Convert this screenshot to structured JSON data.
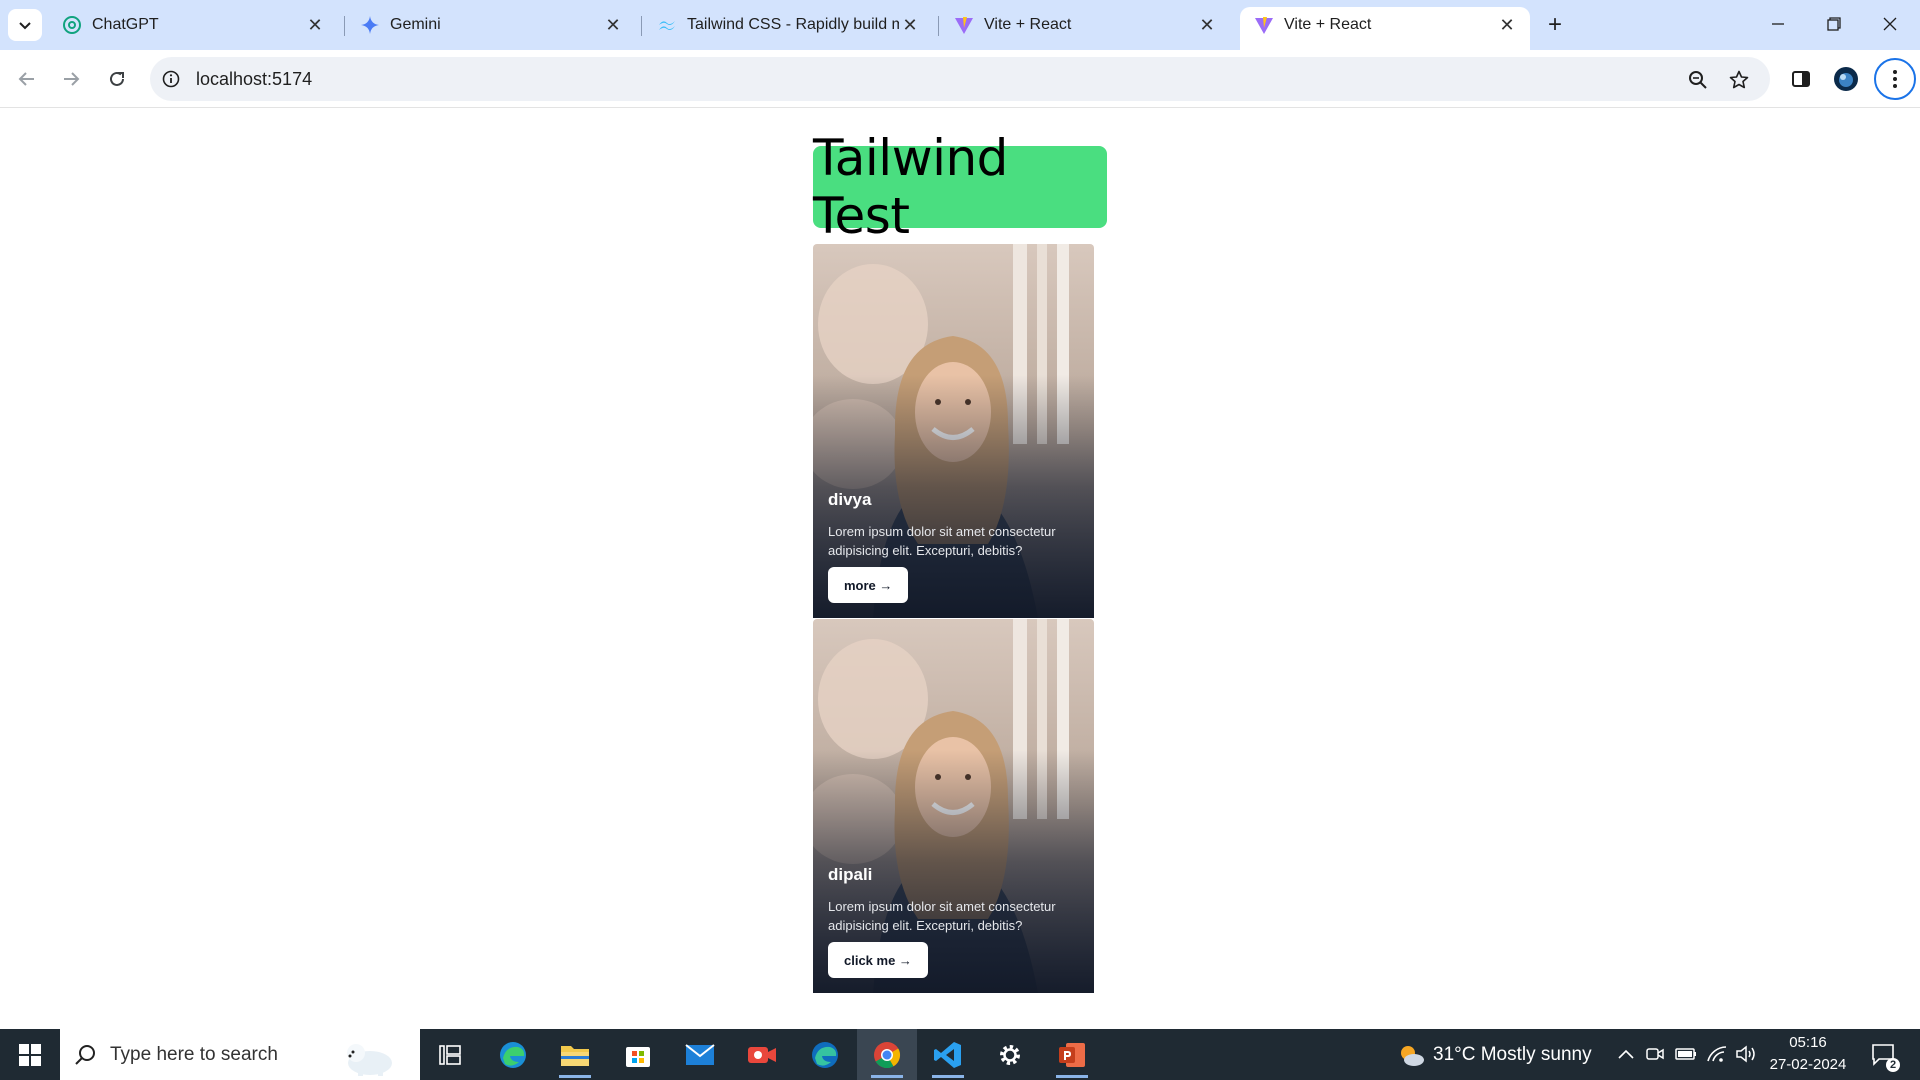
{
  "browser": {
    "tabs": [
      {
        "title": "ChatGPT",
        "icon": "chatgpt-icon",
        "active": false
      },
      {
        "title": "Gemini",
        "icon": "gemini-icon",
        "active": false
      },
      {
        "title": "Tailwind CSS - Rapidly build mo",
        "icon": "tailwind-icon",
        "active": false
      },
      {
        "title": "Vite + React",
        "icon": "vite-icon",
        "active": false
      },
      {
        "title": "Vite + React",
        "icon": "vite-icon",
        "active": true
      }
    ],
    "url": "localhost:5174"
  },
  "page": {
    "heading": "Tailwind Test",
    "cards": [
      {
        "name": "divya",
        "description": "Lorem ipsum dolor sit amet consectetur adipisicing elit. Excepturi, debitis?",
        "button": "more →"
      },
      {
        "name": "dipali",
        "description": "Lorem ipsum dolor sit amet consectetur adipisicing elit. Excepturi, debitis?",
        "button": "click me →"
      }
    ]
  },
  "taskbar": {
    "search_placeholder": "Type here to search",
    "weather": "31°C  Mostly sunny",
    "time": "05:16",
    "date": "27-02-2024",
    "notification_count": "2"
  },
  "colors": {
    "heading_bg": "#4ade80",
    "tabstrip_bg": "#d3e3fd",
    "taskbar_bg": "#1f2a33"
  }
}
